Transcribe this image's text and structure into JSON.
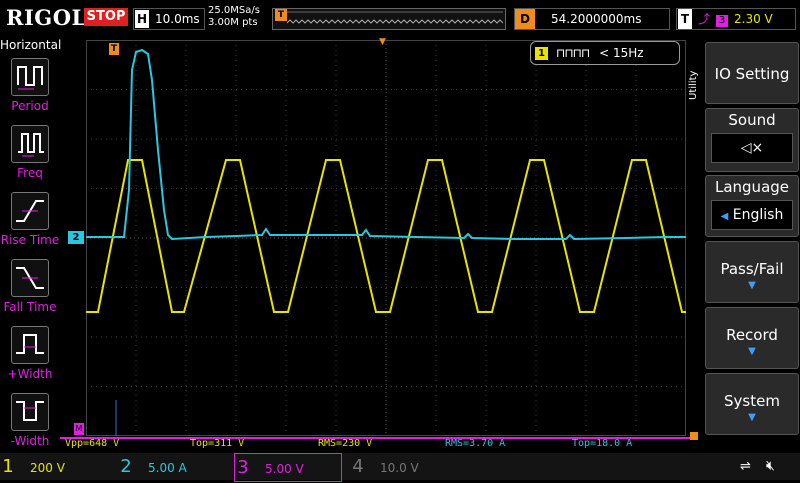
{
  "header": {
    "brand": "RIGOL",
    "run_state": "STOP",
    "horizontal_label": "H",
    "timebase": "10.0ms",
    "sample_rate": "25.0MSa/s",
    "memory_points": "3.00M pts",
    "trigger_marker": "T",
    "delay_label": "D",
    "delay_value": "54.2000000ms",
    "trigger_label": "T",
    "trigger_source": "3",
    "trigger_level": "2.30 V"
  },
  "left_menu": {
    "title": "Horizontal",
    "items": [
      {
        "label": "Period",
        "icon": "period-icon"
      },
      {
        "label": "Freq",
        "icon": "freq-icon"
      },
      {
        "label": "Rise Time",
        "icon": "rise-time-icon"
      },
      {
        "label": "Fall Time",
        "icon": "fall-time-icon"
      },
      {
        "label": "+Width",
        "icon": "pos-width-icon"
      },
      {
        "label": "-Width",
        "icon": "neg-width-icon"
      }
    ]
  },
  "frequency_counter": {
    "channel": "1",
    "value": "< 15Hz"
  },
  "markers": {
    "ch2": "2",
    "ch3": "M",
    "trigger_top": "T"
  },
  "measurements": [
    {
      "text": "Vpp=648 V",
      "color": "#e8e300"
    },
    {
      "text": "Top=311 V",
      "color": "#e8e300"
    },
    {
      "text": "RMS=230 V",
      "color": "#e8e300"
    },
    {
      "text": "RMS=3.70 A",
      "color": "#29c8e0"
    },
    {
      "text": "Top=18.0 A",
      "color": "#29c8e0"
    }
  ],
  "channels": [
    {
      "num": "1",
      "scale": "200 V",
      "color": "#e8e300"
    },
    {
      "num": "2",
      "scale": "5.00 A",
      "color": "#29c8e0"
    },
    {
      "num": "3",
      "scale": "5.00 V",
      "color": "#e020e0"
    },
    {
      "num": "4",
      "scale": "10.0 V",
      "color": "#3a6ae0"
    }
  ],
  "right_menu": {
    "group": "Utility",
    "io_setting": "IO Setting",
    "sound": "Sound",
    "sound_icon": "speaker-mute-icon",
    "language": "Language",
    "language_value": "English",
    "pass_fail": "Pass/Fail",
    "record": "Record",
    "system": "System"
  },
  "colors": {
    "ch1": "#e8e300",
    "ch2": "#29c8e0",
    "ch3": "#e020e0",
    "ch4": "#3a6ae0",
    "trigger": "#f08c1a"
  }
}
